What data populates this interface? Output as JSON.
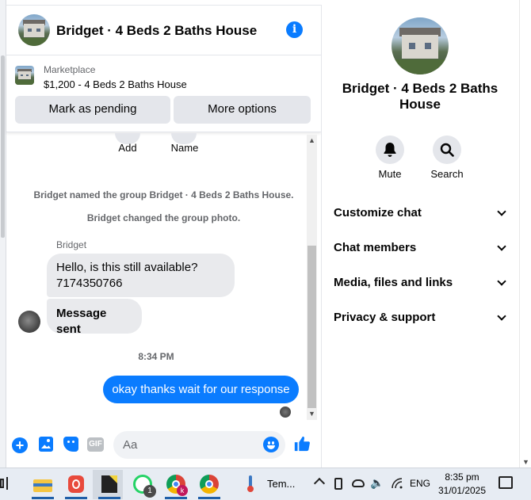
{
  "header": {
    "title": "Bridget · 4 Beds 2 Baths House"
  },
  "marketplace": {
    "label": "Marketplace",
    "title": "$1,200 - 4 Beds 2 Baths House",
    "mark_pending_label": "Mark as pending",
    "more_options_label": "More options"
  },
  "group_actions": {
    "add_label": "Add",
    "name_label": "Name"
  },
  "system_messages": [
    "Bridget named the group Bridget · 4 Beds 2 Baths House.",
    "Bridget changed the group photo."
  ],
  "messages": {
    "sender_name": "Bridget",
    "incoming_1_line1": "Hello, is this still available?",
    "incoming_1_line2": "7174350766",
    "incoming_2": "Message sent",
    "timestamp": "8:34 PM",
    "outgoing_1": "okay thanks wait for our response"
  },
  "composer": {
    "placeholder": "Aa",
    "gif_label": "GIF"
  },
  "right_panel": {
    "title": "Bridget · 4 Beds 2 Baths House",
    "actions": [
      {
        "label": "Mute",
        "icon": "bell-icon"
      },
      {
        "label": "Search",
        "icon": "search-icon"
      }
    ],
    "sections": [
      "Customize chat",
      "Chat members",
      "Media, files and links",
      "Privacy & support"
    ]
  },
  "taskbar": {
    "weather_label": "Tem...",
    "language": "ENG",
    "time": "8:35 pm",
    "date": "31/01/2025",
    "whatsapp_badge": "1",
    "chrome_profile_badge": "k"
  },
  "colors": {
    "accent": "#0a7cff",
    "bubble_incoming": "#e9eaed",
    "button_grey": "#e4e6eb"
  }
}
